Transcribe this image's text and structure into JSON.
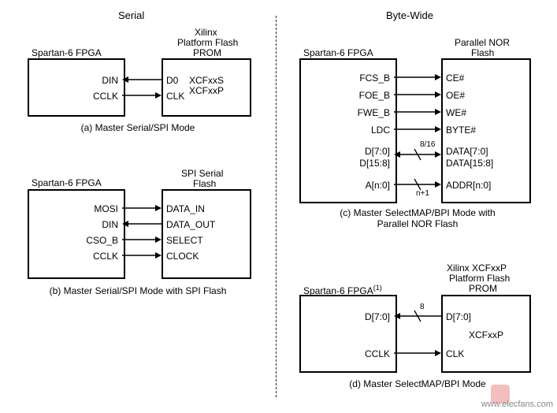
{
  "headers": {
    "left": "Serial",
    "right": "Byte-Wide"
  },
  "a": {
    "fpga_title": "Spartan-6 FPGA",
    "flash_title1": "Xilinx",
    "flash_title2": "Platform Flash",
    "flash_title3": "PROM",
    "pins_fpga": [
      "DIN",
      "CCLK"
    ],
    "pins_flash": [
      "D0",
      "CLK"
    ],
    "flash_inner1": "XCFxxS",
    "flash_inner2": "XCFxxP",
    "caption": "(a) Master Serial/SPI Mode"
  },
  "b": {
    "fpga_title": "Spartan-6 FPGA",
    "flash_title1": "SPI Serial",
    "flash_title2": "Flash",
    "pins_fpga": [
      "MOSI",
      "DIN",
      "CSO_B",
      "CCLK"
    ],
    "pins_flash": [
      "DATA_IN",
      "DATA_OUT",
      "SELECT",
      "CLOCK"
    ],
    "caption": "(b) Master Serial/SPI Mode with SPI Flash"
  },
  "c": {
    "fpga_title": "Spartan-6 FPGA",
    "flash_title1": "Parallel NOR",
    "flash_title2": "Flash",
    "pins_fpga": [
      "FCS_B",
      "FOE_B",
      "FWE_B",
      "LDC",
      "D[7:0]",
      "D[15:8]",
      "A[n:0]"
    ],
    "pins_flash": [
      "CE#",
      "OE#",
      "WE#",
      "BYTE#",
      "DATA[7:0]",
      "DATA[15:8]",
      "ADDR[n:0]"
    ],
    "bus1": "8/16",
    "bus2": "n+1",
    "caption": "(c) Master SelectMAP/BPI Mode with Parallel NOR Flash"
  },
  "d": {
    "fpga_title": "Spartan-6 FPGA",
    "fpga_note": "(1)",
    "flash_title1": "Xilinx XCFxxP",
    "flash_title2": "Platform Flash",
    "flash_title3": "PROM",
    "pins_fpga": [
      "D[7:0]",
      "CCLK"
    ],
    "pins_flash": [
      "D[7:0]",
      "CLK"
    ],
    "flash_inner": "XCFxxP",
    "bus": "8",
    "caption": "(d) Master SelectMAP/BPI Mode"
  },
  "watermark": "www.elecfans.com"
}
